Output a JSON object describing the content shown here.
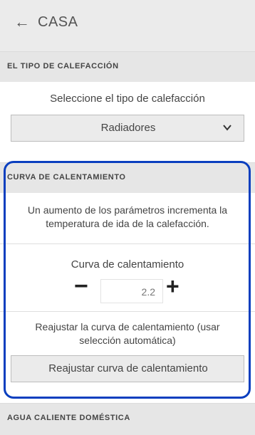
{
  "header": {
    "back_icon": "arrow-left-icon",
    "title": "CASA"
  },
  "heating_type": {
    "section_title": "EL TIPO DE CALEFACCIÓN",
    "prompt": "Seleccione el tipo de calefacción",
    "selected": "Radiadores"
  },
  "heating_curve": {
    "section_title": "CURVA DE CALENTAMIENTO",
    "description": "Un aumento de los parámetros incrementa la temperatura de ida de la calefacción.",
    "stepper_label": "Curva de calentamiento",
    "minus_label": "−",
    "plus_label": "+",
    "value": "2.2",
    "reset_text": "Reajustar la curva de calentamiento (usar selección automática)",
    "reset_button": "Reajustar curva de calentamiento",
    "highlight_color": "#0a3fbf"
  },
  "hot_water": {
    "section_title": "AGUA CALIENTE DOMÉSTICA"
  }
}
